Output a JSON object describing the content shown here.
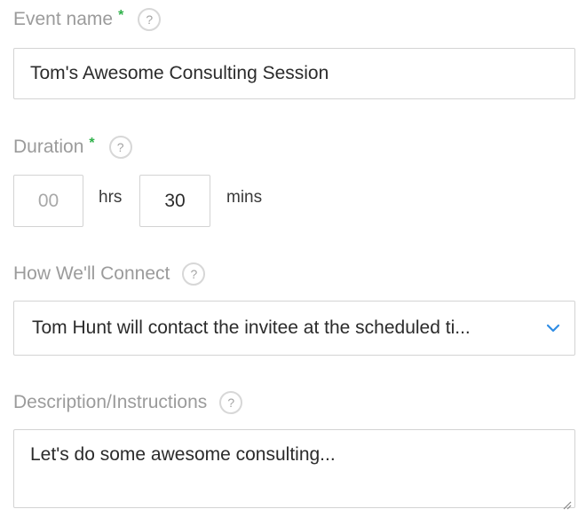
{
  "event_name": {
    "label": "Event name",
    "required_mark": "*",
    "help_icon": "?",
    "value": "Tom's Awesome Consulting Session"
  },
  "duration": {
    "label": "Duration",
    "required_mark": "*",
    "help_icon": "?",
    "hours_value": "00",
    "hours_unit": "hrs",
    "minutes_value": "30",
    "minutes_unit": "mins"
  },
  "connect": {
    "label": "How We'll Connect",
    "help_icon": "?",
    "selected_value": "Tom Hunt will contact the invitee at the scheduled ti...",
    "dropdown_icon": "chevron-down-icon"
  },
  "description": {
    "label": "Description/Instructions",
    "help_icon": "?",
    "value": "Let's do some awesome consulting..."
  },
  "colors": {
    "label_text": "#9b9b9b",
    "required_star": "#2fb14a",
    "chevron": "#2f8de4",
    "border": "#d3d3d3"
  }
}
